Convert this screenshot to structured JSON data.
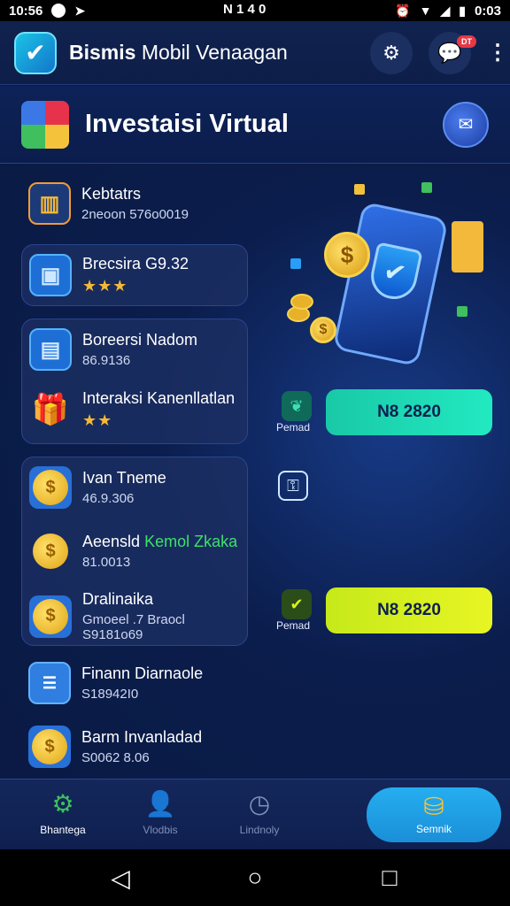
{
  "statusbar": {
    "time": "10:56",
    "center_text": "N 1 4 0",
    "clock": "0:03"
  },
  "appbar": {
    "title_bold": "Bismis",
    "title_rest": "Mobil Venaagan",
    "notification_badge": "DT"
  },
  "section": {
    "title": "Investaisi Virtual"
  },
  "left_items": [
    {
      "title": "Kebtatrs",
      "sub": "2neoon 576o0019"
    },
    {
      "title": "Brecsira G9.32",
      "stars": "★★★"
    },
    {
      "title": "Boreersi Nadom",
      "sub": "86.9136"
    },
    {
      "title": "Interaksi Kanenllatlan",
      "stars": "★★"
    },
    {
      "title": "Ivan Tneme",
      "sub": "46.9.306"
    },
    {
      "title": "Aeensld",
      "title_green": "Kemol Zkaka",
      "sub": "81.0013"
    },
    {
      "title": "Dralinaika",
      "sub": "Gmoeel .7 Braocl S9181o69"
    },
    {
      "title": "Finann Diarnaole",
      "sub": "S18942I0"
    },
    {
      "title": "Barm Invanladad",
      "sub": "S0062 8.06"
    }
  ],
  "cta1": {
    "value": "N8 2820",
    "label": "Pemad"
  },
  "cta2": {
    "value": "N8 2820",
    "label": "Pemad"
  },
  "bottomnav": {
    "items": [
      {
        "label": "Bhantega"
      },
      {
        "label": "Vlodbis"
      },
      {
        "label": "Lindnoly"
      },
      {
        "label": "Semnik"
      }
    ]
  },
  "colors": {
    "background": "#0b1a44",
    "cta1": "#1fe0b0",
    "cta2": "#d8f11f",
    "accent": "#25aef0"
  }
}
